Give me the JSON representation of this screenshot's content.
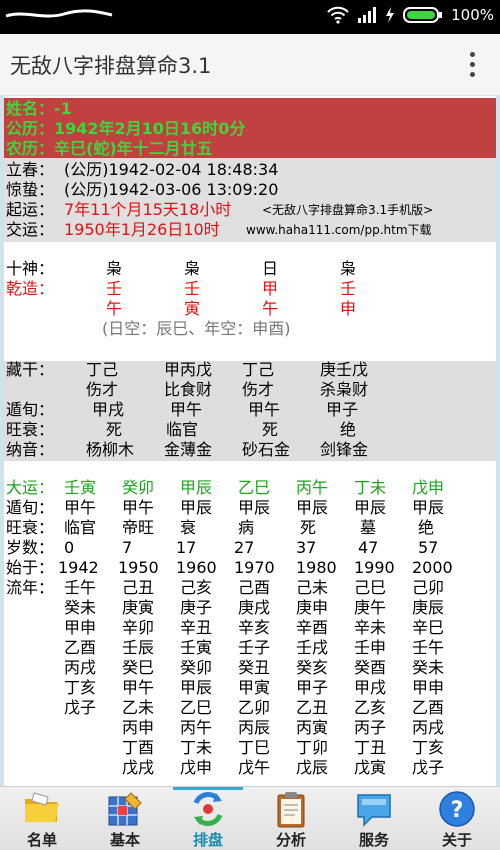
{
  "status_bar": {
    "battery": "100%"
  },
  "app": {
    "title": "无敌八字排盘算命3.1"
  },
  "header": {
    "name": "姓名：-1",
    "solar": "公历：1942年2月10日16时0分",
    "lunar": "农历：辛巳(蛇)年十二月廿五"
  },
  "terms": {
    "lichun_label": "立春：",
    "lichun_value": "(公历)1942-02-04 18:48:34",
    "jingzhe_label": "惊蛰：",
    "jingzhe_value": "(公历)1942-03-06 13:09:20",
    "qiyun_label": "起运：",
    "qiyun_value": "7年11个月15天18小时",
    "qiyun_note": "<无敌八字排盘算命3.1手机版>",
    "jiaoyun_label": "交运：",
    "jiaoyun_value": "1950年1月26日10时",
    "jiaoyun_note": "www.haha111.com/pp.htm下载"
  },
  "pillars": {
    "shishen_label": "十神：",
    "shishen": [
      "枭",
      "枭",
      "日",
      "枭"
    ],
    "qianzao_label": "乾造：",
    "stems": [
      "壬",
      "壬",
      "甲",
      "壬"
    ],
    "branches": [
      "午",
      "寅",
      "午",
      "申"
    ],
    "kongwang": "(日空：辰巳、年空：申酉)"
  },
  "details": {
    "canggan_label": "藏干：",
    "canggan": [
      "丁己",
      "甲丙戊",
      "丁己",
      "庚壬戊"
    ],
    "canggan_shishen": [
      "伤才",
      "比食财",
      "伤才",
      "杀枭财"
    ],
    "xunshou_label": "遁旬：",
    "xunshou": [
      "甲戌",
      "甲午",
      "甲午",
      "甲子"
    ],
    "wangshuai_label": "旺衰：",
    "wangshuai": [
      "死",
      "临官",
      "死",
      "绝"
    ],
    "nayin_label": "纳音：",
    "nayin": [
      "杨柳木",
      "金薄金",
      "砂石金",
      "剑锋金"
    ]
  },
  "dayun": {
    "dayun_label": "大运：",
    "dayun": [
      "壬寅",
      "癸卯",
      "甲辰",
      "乙巳",
      "丙午",
      "丁未",
      "戊申"
    ],
    "xunshou_label": "遁旬：",
    "xunshou": [
      "甲午",
      "甲午",
      "甲辰",
      "甲辰",
      "甲辰",
      "甲辰",
      "甲辰"
    ],
    "wangshuai_label": "旺衰：",
    "wangshuai": [
      "临官",
      "帝旺",
      "衰",
      "病",
      "死",
      "墓",
      "绝"
    ],
    "age_label": "岁数：",
    "ages": [
      "0",
      "7",
      "17",
      "27",
      "37",
      "47",
      "57"
    ],
    "start_label": "始于：",
    "start_years": [
      "1942",
      "1950",
      "1960",
      "1970",
      "1980",
      "1990",
      "2000"
    ],
    "liunian_label": "流年：",
    "liunian": [
      [
        "壬午",
        "己丑",
        "己亥",
        "己酉",
        "己未",
        "己巳",
        "己卯"
      ],
      [
        "癸未",
        "庚寅",
        "庚子",
        "庚戌",
        "庚申",
        "庚午",
        "庚辰"
      ],
      [
        "甲申",
        "辛卯",
        "辛丑",
        "辛亥",
        "辛酉",
        "辛未",
        "辛巳"
      ],
      [
        "乙酉",
        "壬辰",
        "壬寅",
        "壬子",
        "壬戌",
        "壬申",
        "壬午"
      ],
      [
        "丙戌",
        "癸巳",
        "癸卯",
        "癸丑",
        "癸亥",
        "癸酉",
        "癸未"
      ],
      [
        "丁亥",
        "甲午",
        "甲辰",
        "甲寅",
        "甲子",
        "甲戌",
        "甲申"
      ],
      [
        "戊子",
        "乙未",
        "乙巳",
        "乙卯",
        "乙丑",
        "乙亥",
        "乙酉"
      ],
      [
        "",
        "丙申",
        "丙午",
        "丙辰",
        "丙寅",
        "丙子",
        "丙戌"
      ],
      [
        "",
        "丁酉",
        "丁未",
        "丁巳",
        "丁卯",
        "丁丑",
        "丁亥"
      ],
      [
        "",
        "戊戌",
        "戊申",
        "戊午",
        "戊辰",
        "戊寅",
        "戊子"
      ]
    ]
  },
  "tabs": [
    {
      "label": "名单",
      "icon": "folder-icon"
    },
    {
      "label": "基本",
      "icon": "grid-pen-icon"
    },
    {
      "label": "排盘",
      "icon": "refresh-cycle-icon"
    },
    {
      "label": "分析",
      "icon": "clipboard-icon"
    },
    {
      "label": "服务",
      "icon": "speech-bubble-icon"
    },
    {
      "label": "关于",
      "icon": "help-icon"
    }
  ],
  "active_tab": "排盘",
  "colors": {
    "header_band": "#c0413f",
    "header_text": "#3dd63d",
    "accent_red": "#e81010",
    "dayun_green": "#1fa31f",
    "active_tab": "#1c8bb0"
  }
}
